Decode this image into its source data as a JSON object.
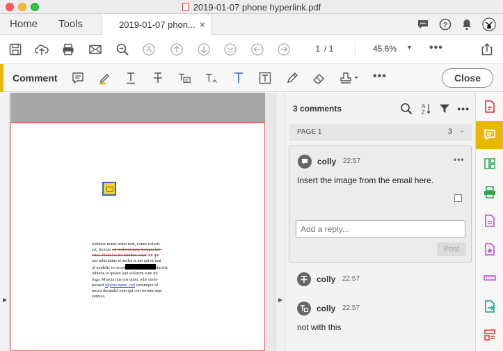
{
  "window": {
    "title": "2019-01-07 phone hyperlink.pdf"
  },
  "tabs": {
    "home": "Home",
    "tools": "Tools",
    "document": "2019-01-07 phon...",
    "close_symbol": "×"
  },
  "toolbar": {
    "page_current": "1",
    "page_total": "/ 1",
    "zoom": "45.6%",
    "zoom_caret": "▼",
    "more": "•••"
  },
  "comment_toolbar": {
    "label": "Comment",
    "close_label": "Close",
    "more": "•••"
  },
  "document": {
    "lines": [
      {
        "parts": [
          {
            "t": "Seditios nonse arum nest, cones volorts"
          }
        ]
      },
      {
        "parts": [
          {
            "t": "est, Incium "
          },
          {
            "t": "od molorcietam, kenqua ber-",
            "s": "strike"
          }
        ]
      },
      {
        "parts": [
          {
            "t": "ortal. Ment lacero minime valar",
            "s": "strike"
          },
          {
            "t": " aut qui"
          }
        ]
      },
      {
        "parts": [
          {
            "t": "nos nihicitatus et moles ts aut qut ut laut"
          }
        ]
      },
      {
        "parts": [
          {
            "t": "id quidelic to occae"
          },
          {
            "t": "",
            "s": "redact"
          },
          {
            "t": "ductrit,"
          }
        ]
      },
      {
        "parts": [
          {
            "t": "oditatis ut quiant laut volorem eum tm"
          }
        ]
      },
      {
        "parts": [
          {
            "t": "fuga. Muscia nus eos utam, odis utem-"
          }
        ]
      },
      {
        "parts": [
          {
            "t": "posseri "
          },
          {
            "t": "ulparis natur, cud",
            "s": "uline"
          },
          {
            "t": " verumquo id"
          }
        ]
      },
      {
        "parts": [
          {
            "t": "mossi dusandel eum qui con rerrum aspe"
          }
        ]
      },
      {
        "parts": [
          {
            "t": "enimus."
          }
        ]
      }
    ]
  },
  "panel": {
    "count_label": "3 comments",
    "page_group": {
      "label": "PAGE 1",
      "count": "3",
      "caret": "⌄"
    },
    "comments": [
      {
        "user": "colly",
        "time": "22:57",
        "text": "Insert the image from the email here.",
        "more": "•••"
      },
      {
        "user": "colly",
        "time": "22:57",
        "text": ""
      },
      {
        "user": "colly",
        "time": "22:57",
        "text": "not with this"
      }
    ],
    "reply_placeholder": "Add a reply...",
    "post_label": "Post"
  },
  "colors": {
    "accent": "#e8b800",
    "link": "#2c6cb5",
    "strike": "#b8272c"
  },
  "rail_icons": [
    "create-pdf-icon",
    "comment-icon",
    "organize-pages-icon",
    "scan-icon",
    "edit-pdf-icon",
    "export-pdf-icon",
    "measure-icon",
    "send-for-review-icon",
    "more-tools-icon"
  ]
}
